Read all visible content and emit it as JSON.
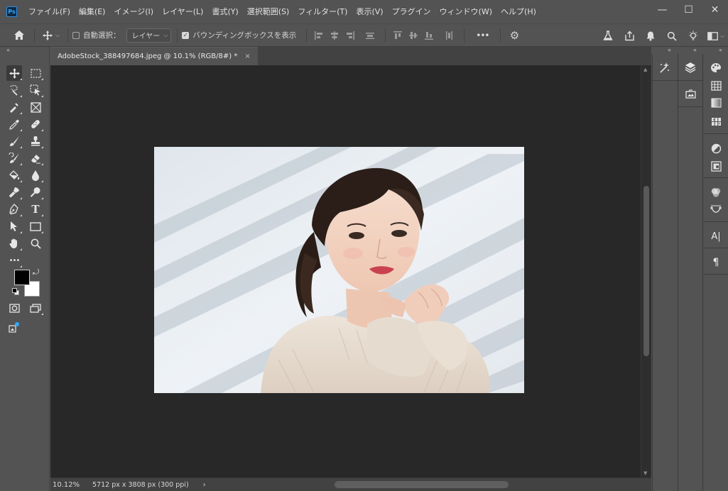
{
  "app": {
    "logo": "Ps"
  },
  "menu": [
    "ファイル(F)",
    "編集(E)",
    "イメージ(I)",
    "レイヤー(L)",
    "書式(Y)",
    "選択範囲(S)",
    "フィルター(T)",
    "表示(V)",
    "プラグイン",
    "ウィンドウ(W)",
    "ヘルプ(H)"
  ],
  "window_controls": {
    "minimize": "—",
    "maximize": "☐",
    "close": "✕"
  },
  "options": {
    "auto_select_label": "自動選択：",
    "auto_select_checked": false,
    "auto_select_target": "レイヤー",
    "bounding_box_label": "バウンディングボックスを表示",
    "bounding_box_checked": true,
    "more": "•••"
  },
  "document": {
    "tab_title": "AdobeStock_388497684.jpeg @ 10.1% (RGB/8#) *",
    "close": "×"
  },
  "status": {
    "zoom": "10.12%",
    "info": "5712 px x 3808 px (300 ppi)",
    "arrow": "›"
  },
  "collapse_glyph": "«",
  "tools": {
    "text_tool_glyph": "T",
    "more_tools_glyph": "•••"
  },
  "panels": {
    "character_glyph": "A|",
    "paragraph_glyph": "¶"
  },
  "colors": {
    "foreground": "#000000",
    "background": "#ffffff",
    "accent": "#31a8ff"
  }
}
